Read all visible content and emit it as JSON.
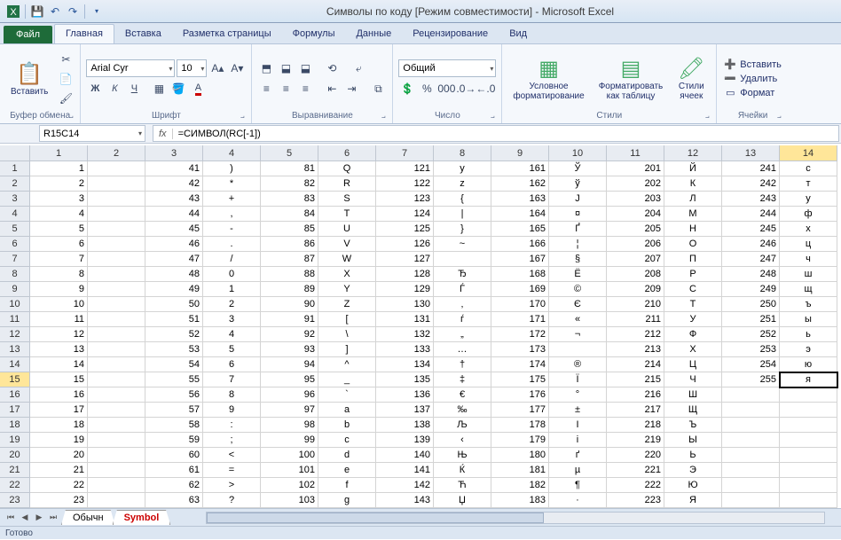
{
  "title": "Символы по коду  [Режим совместимости]  -  Microsoft Excel",
  "tabs": {
    "file": "Файл",
    "home": "Главная",
    "insert": "Вставка",
    "layout": "Разметка страницы",
    "formulas": "Формулы",
    "data": "Данные",
    "review": "Рецензирование",
    "view": "Вид"
  },
  "ribbon": {
    "clipboard": {
      "paste": "Вставить",
      "label": "Буфер обмена"
    },
    "font": {
      "name": "Arial Cyr",
      "size": "10",
      "label": "Шрифт"
    },
    "align": {
      "label": "Выравнивание"
    },
    "number": {
      "format": "Общий",
      "label": "Число"
    },
    "styles": {
      "cond": "Условное\nформатирование",
      "table": "Форматировать\nкак таблицу",
      "cell": "Стили\nячеек",
      "label": "Стили"
    },
    "cells": {
      "insert": "Вставить",
      "delete": "Удалить",
      "format": "Формат",
      "label": "Ячейки"
    }
  },
  "namebox": "R15C14",
  "formula": "=СИМВОЛ(RC[-1])",
  "columns": [
    "1",
    "2",
    "3",
    "4",
    "5",
    "6",
    "7",
    "8",
    "9",
    "10",
    "11",
    "12",
    "13",
    "14"
  ],
  "rows": [
    [
      "1",
      "",
      "41",
      ")",
      "81",
      "Q",
      "121",
      "y",
      "161",
      "Ў",
      "201",
      "Й",
      "241",
      "с"
    ],
    [
      "2",
      "",
      "42",
      "*",
      "82",
      "R",
      "122",
      "z",
      "162",
      "ў",
      "202",
      "К",
      "242",
      "т"
    ],
    [
      "3",
      "",
      "43",
      "+",
      "83",
      "S",
      "123",
      "{",
      "163",
      "Ј",
      "203",
      "Л",
      "243",
      "у"
    ],
    [
      "4",
      "",
      "44",
      ",",
      "84",
      "T",
      "124",
      "|",
      "164",
      "¤",
      "204",
      "М",
      "244",
      "ф"
    ],
    [
      "5",
      "",
      "45",
      "-",
      "85",
      "U",
      "125",
      "}",
      "165",
      "Ґ",
      "205",
      "Н",
      "245",
      "х"
    ],
    [
      "6",
      "",
      "46",
      ".",
      "86",
      "V",
      "126",
      "~",
      "166",
      "¦",
      "206",
      "О",
      "246",
      "ц"
    ],
    [
      "7",
      "",
      "47",
      "/",
      "87",
      "W",
      "127",
      "",
      "167",
      "§",
      "207",
      "П",
      "247",
      "ч"
    ],
    [
      "8",
      "",
      "48",
      "0",
      "88",
      "X",
      "128",
      "Ђ",
      "168",
      "Ё",
      "208",
      "Р",
      "248",
      "ш"
    ],
    [
      "9",
      "",
      "49",
      "1",
      "89",
      "Y",
      "129",
      "Ѓ",
      "169",
      "©",
      "209",
      "С",
      "249",
      "щ"
    ],
    [
      "10",
      "",
      "50",
      "2",
      "90",
      "Z",
      "130",
      "‚",
      "170",
      "Є",
      "210",
      "Т",
      "250",
      "ъ"
    ],
    [
      "11",
      "",
      "51",
      "3",
      "91",
      "[",
      "131",
      "ѓ",
      "171",
      "«",
      "211",
      "У",
      "251",
      "ы"
    ],
    [
      "12",
      "",
      "52",
      "4",
      "92",
      "\\",
      "132",
      "„",
      "172",
      "¬",
      "212",
      "Ф",
      "252",
      "ь"
    ],
    [
      "13",
      "",
      "53",
      "5",
      "93",
      "]",
      "133",
      "…",
      "173",
      "­",
      "213",
      "Х",
      "253",
      "э"
    ],
    [
      "14",
      "",
      "54",
      "6",
      "94",
      "^",
      "134",
      "†",
      "174",
      "®",
      "214",
      "Ц",
      "254",
      "ю"
    ],
    [
      "15",
      "",
      "55",
      "7",
      "95",
      "_",
      "135",
      "‡",
      "175",
      "Ї",
      "215",
      "Ч",
      "255",
      "я"
    ],
    [
      "16",
      "",
      "56",
      "8",
      "96",
      "`",
      "136",
      "€",
      "176",
      "°",
      "216",
      "Ш",
      "",
      ""
    ],
    [
      "17",
      "",
      "57",
      "9",
      "97",
      "a",
      "137",
      "‰",
      "177",
      "±",
      "217",
      "Щ",
      "",
      ""
    ],
    [
      "18",
      "",
      "58",
      ":",
      "98",
      "b",
      "138",
      "Љ",
      "178",
      "І",
      "218",
      "Ъ",
      "",
      ""
    ],
    [
      "19",
      "",
      "59",
      ";",
      "99",
      "c",
      "139",
      "‹",
      "179",
      "і",
      "219",
      "Ы",
      "",
      ""
    ],
    [
      "20",
      "",
      "60",
      "<",
      "100",
      "d",
      "140",
      "Њ",
      "180",
      "ґ",
      "220",
      "Ь",
      "",
      ""
    ],
    [
      "21",
      "",
      "61",
      "=",
      "101",
      "e",
      "141",
      "Ќ",
      "181",
      "µ",
      "221",
      "Э",
      "",
      ""
    ],
    [
      "22",
      "",
      "62",
      ">",
      "102",
      "f",
      "142",
      "Ћ",
      "182",
      "¶",
      "222",
      "Ю",
      "",
      ""
    ],
    [
      "23",
      "",
      "63",
      "?",
      "103",
      "g",
      "143",
      "Џ",
      "183",
      "·",
      "223",
      "Я",
      "",
      ""
    ]
  ],
  "sheets": {
    "s1": "Обычн",
    "s2": "Symbol"
  },
  "status": "Готово",
  "active_row": 15,
  "active_col": 14
}
